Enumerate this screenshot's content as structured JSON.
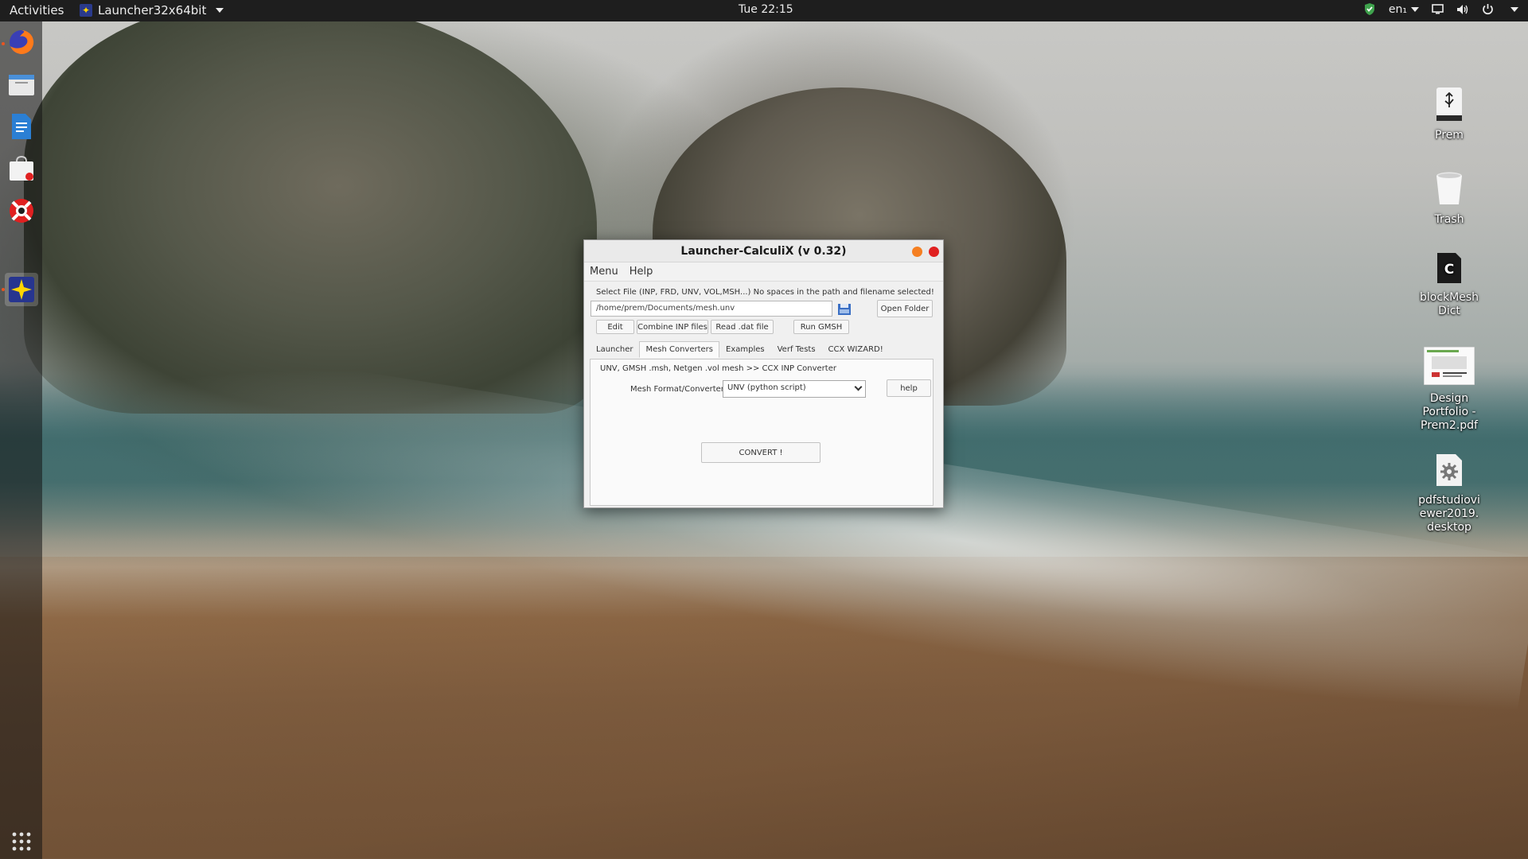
{
  "topbar": {
    "activities": "Activities",
    "app_menu": "Launcher32x64bit",
    "clock": "Tue 22:15",
    "lang": "en₁"
  },
  "dock": {
    "items": [
      "firefox-icon",
      "files-icon",
      "writer-icon",
      "software-icon",
      "help-icon",
      "launcher-icon"
    ],
    "show_apps": "show-apps-icon"
  },
  "desktop": {
    "icons": [
      {
        "label": "Prem",
        "icon": "usb-drive-icon"
      },
      {
        "label": "Trash",
        "icon": "trash-icon"
      },
      {
        "label": "blockMesh\nDict",
        "icon": "c-file-icon"
      },
      {
        "label": "Design\nPortfolio -\nPrem2.pdf",
        "icon": "pdf-thumbnail-icon"
      },
      {
        "label": "pdfstudiovi\newer2019.\ndesktop",
        "icon": "gear-file-icon"
      }
    ]
  },
  "window": {
    "title": "Launcher-CalculiX (v 0.32)",
    "menu": [
      "Menu",
      "Help"
    ],
    "file_hint": "Select File (INP, FRD, UNV, VOL,MSH...) No spaces in the path and filename selected!",
    "file_path": "/home/prem/Documents/mesh.unv",
    "open_folder": "Open Folder",
    "buttons": [
      "Edit",
      "Combine INP files",
      "Read .dat file",
      "Run GMSH"
    ],
    "tabs": [
      "Launcher",
      "Mesh Converters",
      "Examples",
      "Verf Tests",
      "CCX WIZARD!"
    ],
    "active_tab": "Mesh Converters",
    "panel": {
      "heading": "UNV, GMSH .msh, Netgen .vol mesh >> CCX INP Converter",
      "format_label": "Mesh Format/Converter",
      "format_value": "UNV (python script)",
      "help": "help",
      "convert": "CONVERT !"
    }
  },
  "colors": {
    "topbar": "#1e1e1e",
    "minimize": "#f57f21",
    "close": "#e02020",
    "dock_indicator": "#e95420"
  }
}
